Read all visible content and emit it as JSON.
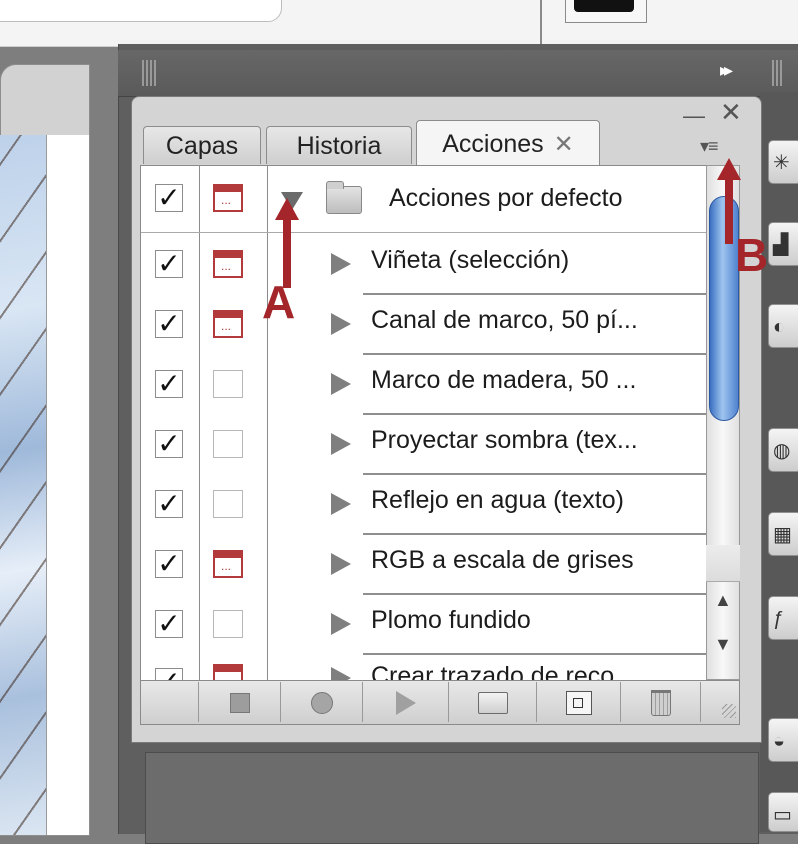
{
  "tabs": [
    {
      "label": "Capas"
    },
    {
      "label": "Historia"
    },
    {
      "label": "Acciones",
      "close_glyph": "✕"
    }
  ],
  "window_controls": {
    "minimize": "—",
    "close": "✕",
    "panel_menu": "▾≡",
    "dock_arrows": "▸▸"
  },
  "actions_list": {
    "group": {
      "label": "Acciones por defecto",
      "expanded": true,
      "checked": true,
      "dialog": true
    },
    "items": [
      {
        "label": "Viñeta (selección)",
        "checked": true,
        "dialog": true
      },
      {
        "label": "Canal de marco, 50 pí...",
        "checked": true,
        "dialog": true
      },
      {
        "label": "Marco de madera, 50 ...",
        "checked": true,
        "dialog": false
      },
      {
        "label": "Proyectar sombra (tex...",
        "checked": true,
        "dialog": false
      },
      {
        "label": "Reflejo en agua (texto)",
        "checked": true,
        "dialog": false
      },
      {
        "label": "RGB a escala de grises",
        "checked": true,
        "dialog": true
      },
      {
        "label": "Plomo fundido",
        "checked": true,
        "dialog": false
      },
      {
        "label": "Crear trazado de reco...",
        "checked": true,
        "dialog": true
      }
    ]
  },
  "toolbar": [
    "stop-recording",
    "start-recording",
    "play-selection",
    "create-new-set",
    "create-new-action",
    "delete"
  ],
  "annotations": [
    {
      "letter": "A",
      "color": "#a4262a"
    },
    {
      "letter": "B",
      "color": "#a4262a"
    }
  ],
  "glyphs": {
    "check": "✓",
    "dialog_dots": "...",
    "scroll_up": "▲",
    "scroll_down": "▼"
  }
}
